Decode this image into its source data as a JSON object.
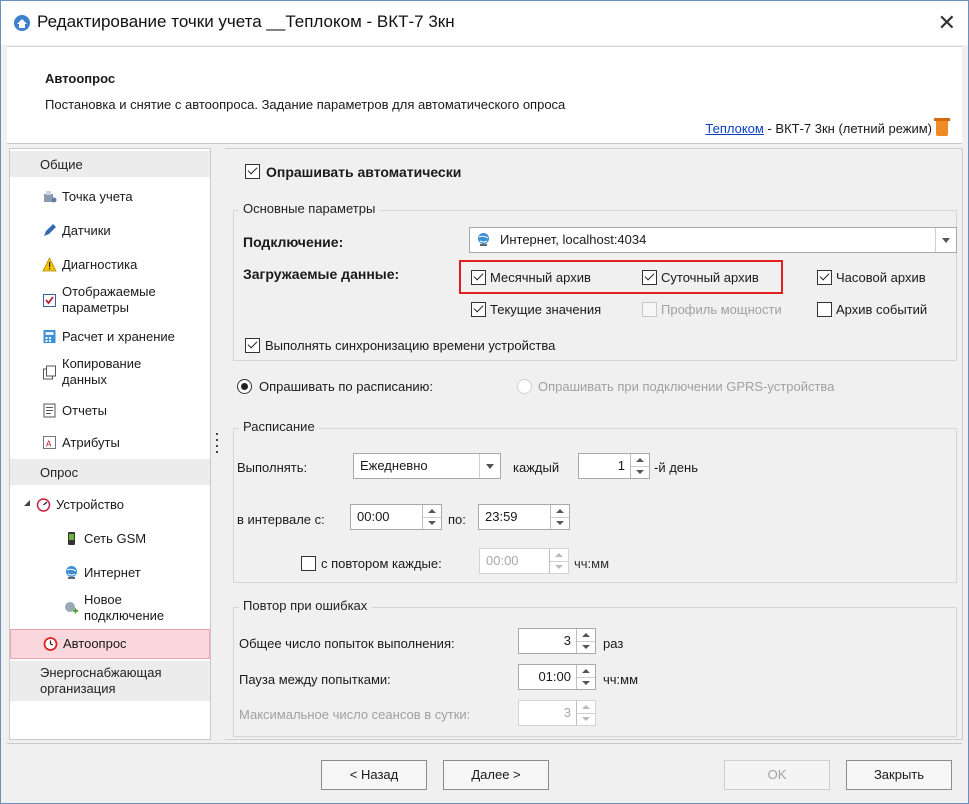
{
  "window": {
    "title": "Редактирование точки учета __Теплоком - ВКТ-7 3кн",
    "close_glyph": "✕"
  },
  "header": {
    "title": "Автоопрос",
    "description": "Постановка и снятие с автоопроса. Задание параметров для автоматического опроса",
    "link_text": "Теплоком",
    "device_text": " - ВКТ-7 3кн (летний режим)"
  },
  "sidebar": {
    "group_general": "Общие",
    "tochka": "Точка учета",
    "datchiki": "Датчики",
    "diagnostika": "Диагностика",
    "otobr_1": "Отображаемые",
    "otobr_2": "параметры",
    "raschet": "Расчет и хранение",
    "kopir_1": "Копирование",
    "kopir_2": "данных",
    "otchety": "Отчеты",
    "atributy": "Атрибуты",
    "group_opros": "Опрос",
    "ustroystvo": "Устройство",
    "gsm": "Сеть GSM",
    "internet": "Интернет",
    "novoe_1": "Новое",
    "novoe_2": "подключение",
    "avtoopros": "Автоопрос",
    "energo_1": "Энергоснабжающая",
    "energo_2": "организация"
  },
  "main": {
    "auto_poll_label": "Опрашивать автоматически",
    "basic_params_legend": "Основные параметры",
    "connection_label": "Подключение:",
    "connection_value": "Интернет, localhost:4034",
    "data_label": "Загружаемые данные:",
    "cb_monthly": "Месячный архив",
    "cb_daily": "Суточный архив",
    "cb_hourly": "Часовой архив",
    "cb_current": "Текущие значения",
    "cb_power": "Профиль мощности",
    "cb_events": "Архив событий",
    "sync_label": "Выполнять синхронизацию времени устройства",
    "radio_schedule": "Опрашивать по расписанию:",
    "radio_gprs": "Опрашивать при подключении GPRS-устройства",
    "schedule_legend": "Расписание",
    "execute_label": "Выполнять:",
    "execute_value": "Ежедневно",
    "every_label": "каждый",
    "every_value": "1",
    "day_suffix": "-й день",
    "interval_from_label": "в интервале с:",
    "interval_from": "00:00",
    "interval_to_label": "по:",
    "interval_to": "23:59",
    "repeat_label": "с повтором каждые:",
    "repeat_value": "00:00",
    "hhmm": "чч:мм",
    "retry_legend": "Повтор при ошибках",
    "total_tries_label": "Общее число попыток выполнения:",
    "total_tries": "3",
    "times": "раз",
    "pause_label": "Пауза между попытками:",
    "pause_value": "01:00",
    "max_sessions_label": "Максимальное число сеансов в сутки:",
    "max_sessions": "3"
  },
  "footer": {
    "back": "< Назад",
    "next": "Далее >",
    "ok": "OK",
    "close": "Закрыть"
  },
  "colors": {
    "highlight_box": "#e0201e",
    "selected_nav": "#f9d7dd",
    "link": "#0a3fc2"
  }
}
